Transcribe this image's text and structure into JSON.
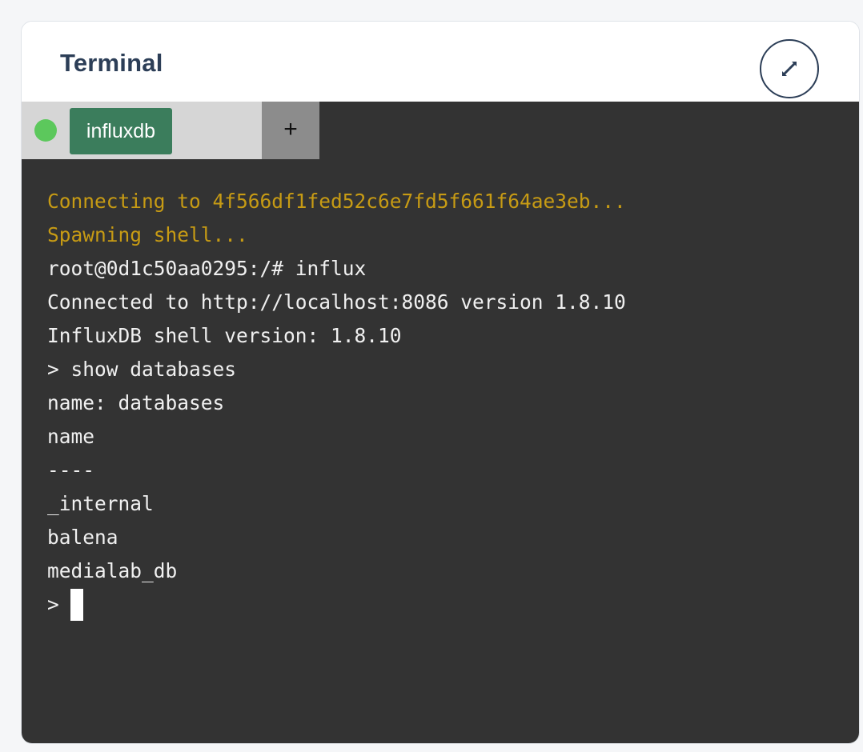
{
  "panel": {
    "title": "Terminal",
    "expand_icon": "expand-arrows-icon"
  },
  "tabs": {
    "status": "connected",
    "status_color": "#5cc85c",
    "items": [
      {
        "label": "influxdb",
        "active": true
      }
    ],
    "add_label": "+"
  },
  "terminal": {
    "background": "#333333",
    "lines": [
      {
        "text": "Connecting to 4f566df1fed52c6e7fd5f661f64ae3eb...",
        "kind": "warn"
      },
      {
        "text": "Spawning shell...",
        "kind": "warn"
      },
      {
        "text": "root@0d1c50aa0295:/# influx",
        "kind": "normal"
      },
      {
        "text": "Connected to http://localhost:8086 version 1.8.10",
        "kind": "normal"
      },
      {
        "text": "InfluxDB shell version: 1.8.10",
        "kind": "normal"
      },
      {
        "text": "> show databases",
        "kind": "normal"
      },
      {
        "text": "name: databases",
        "kind": "normal"
      },
      {
        "text": "name",
        "kind": "normal"
      },
      {
        "text": "----",
        "kind": "normal"
      },
      {
        "text": "_internal",
        "kind": "normal"
      },
      {
        "text": "balena",
        "kind": "normal"
      },
      {
        "text": "medialab_db",
        "kind": "normal"
      }
    ],
    "prompt": ">",
    "warn_color": "#c79b14"
  }
}
